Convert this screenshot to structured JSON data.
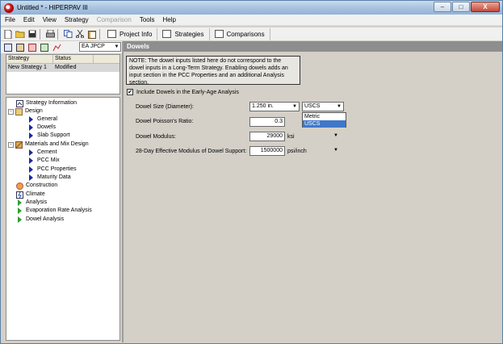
{
  "window": {
    "title": "Untitled * - HIPERPAV III",
    "minimize": "–",
    "maximize": "□",
    "close": "X"
  },
  "menu": [
    "File",
    "Edit",
    "View",
    "Strategy",
    "Comparison",
    "Tools",
    "Help"
  ],
  "menu_disabled": [
    "Comparison"
  ],
  "toolbar": {
    "tabs": [
      "Project Info",
      "Strategies",
      "Comparisons"
    ]
  },
  "strategy_combo": {
    "value": "EA JPCP"
  },
  "strategy_list": {
    "columns": [
      "Strategy",
      "Status"
    ],
    "rows": [
      {
        "strategy": "New Strategy 1",
        "status": "Modified"
      }
    ]
  },
  "tree": [
    {
      "label": "Strategy Information",
      "level": 0,
      "icon": "info-icon"
    },
    {
      "label": "Design",
      "level": 0,
      "icon": "design-icon",
      "expander": "-"
    },
    {
      "label": "General",
      "level": 1,
      "icon": "triangle-icon"
    },
    {
      "label": "Dowels",
      "level": 1,
      "icon": "triangle-icon"
    },
    {
      "label": "Slab Support",
      "level": 1,
      "icon": "triangle-icon"
    },
    {
      "label": "Materials and Mix Design",
      "level": 0,
      "icon": "materials-icon",
      "expander": "-"
    },
    {
      "label": "Cement",
      "level": 1,
      "icon": "triangle-icon"
    },
    {
      "label": "PCC Mix",
      "level": 1,
      "icon": "triangle-icon"
    },
    {
      "label": "PCC Properties",
      "level": 1,
      "icon": "triangle-icon"
    },
    {
      "label": "Maturity Data",
      "level": 1,
      "icon": "triangle-icon"
    },
    {
      "label": "Construction",
      "level": 0,
      "icon": "construction-icon"
    },
    {
      "label": "Climate",
      "level": 0,
      "icon": "climate-icon"
    },
    {
      "label": "Analysis",
      "level": 0,
      "icon": "green-triangle-icon"
    },
    {
      "label": "Evaporation Rate Analysis",
      "level": 0,
      "icon": "green-triangle-icon"
    },
    {
      "label": "Dowel Analysis",
      "level": 0,
      "icon": "green-triangle-icon"
    }
  ],
  "content": {
    "header": "Dowels",
    "note": "NOTE: The dowel inputs listed here do not correspond to the dowel inputs in a Long-Term Strategy. Enabling dowels adds an input section in the PCC Properties and an additional Analysis section.",
    "include_checkbox": {
      "label": "Include Dowels in the Early-Age Analysis",
      "checked": "✔"
    },
    "fields": {
      "dowel_size": {
        "label": "Dowel Size (Diameter):",
        "value": "1.250 in."
      },
      "unit_system": {
        "value": "USCS",
        "options": [
          "Metric",
          "USCS"
        ],
        "selected": "USCS"
      },
      "poisson": {
        "label": "Dowel Poisson's Ratio:",
        "value": "0.3"
      },
      "modulus": {
        "label": "Dowel Modulus:",
        "value": "29000",
        "unit": "ksi"
      },
      "support": {
        "label": "28-Day Effective Modulus of Dowel Support:",
        "value": "1500000",
        "unit": "psi/inch"
      }
    }
  }
}
